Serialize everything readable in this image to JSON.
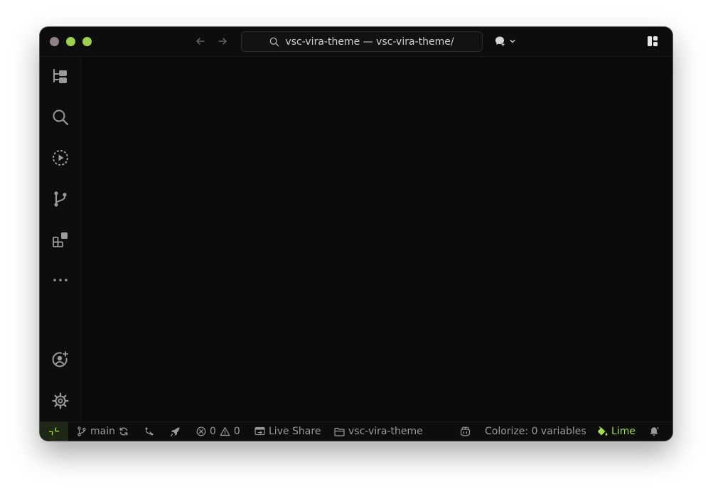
{
  "window": {
    "command_center_text": "vsc-vira-theme — vsc-vira-theme/"
  },
  "icons": {
    "titlebar": [
      "arrow-left-icon",
      "arrow-right-icon",
      "search-icon",
      "copilot-icon",
      "chevron-down-icon",
      "layout-icon"
    ],
    "activitybar": [
      "explorer-icon",
      "search-icon",
      "run-debug-icon",
      "source-control-icon",
      "extensions-icon",
      "more-icon",
      "accounts-icon",
      "settings-gear-icon"
    ],
    "statusbar": [
      "remote-icon",
      "git-branch-icon",
      "sync-icon",
      "pull-request-icon",
      "rocket-icon",
      "error-icon",
      "warning-icon",
      "live-share-icon",
      "folder-icon",
      "copilot-icon",
      "paint-bucket-icon",
      "bell-icon"
    ]
  },
  "status": {
    "branch": "main",
    "errors": "0",
    "warnings": "0",
    "live_share": "Live Share",
    "folder": "vsc-vira-theme",
    "colorize": "Colorize: 0 variables",
    "theme": "Lime"
  },
  "colors": {
    "accent": "#a6dd4d",
    "background": "#0a0a0a",
    "traffic_close": "#8e8282",
    "traffic_min": "#9fd04f",
    "traffic_max": "#9fd04f"
  }
}
